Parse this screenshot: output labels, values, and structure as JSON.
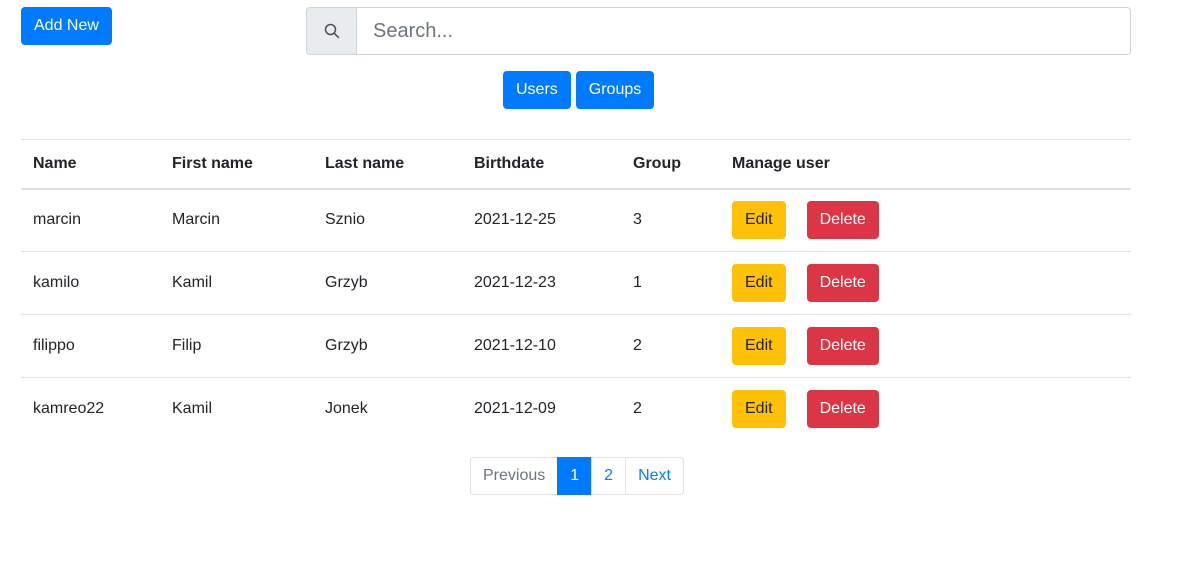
{
  "toolbar": {
    "add_new_label": "Add New"
  },
  "search": {
    "placeholder": "Search..."
  },
  "nav": {
    "users_label": "Users",
    "groups_label": "Groups"
  },
  "table": {
    "headers": [
      "Name",
      "First name",
      "Last name",
      "Birthdate",
      "Group",
      "Manage user"
    ],
    "rows": [
      {
        "name": "marcin",
        "first": "Marcin",
        "last": "Sznio",
        "birthdate": "2021-12-25",
        "group": "3"
      },
      {
        "name": "kamilo",
        "first": "Kamil",
        "last": "Grzyb",
        "birthdate": "2021-12-23",
        "group": "1"
      },
      {
        "name": "filippo",
        "first": "Filip",
        "last": "Grzyb",
        "birthdate": "2021-12-10",
        "group": "2"
      },
      {
        "name": "kamreo22",
        "first": "Kamil",
        "last": "Jonek",
        "birthdate": "2021-12-09",
        "group": "2"
      }
    ],
    "edit_label": "Edit",
    "delete_label": "Delete"
  },
  "pagination": {
    "previous_label": "Previous",
    "pages": [
      "1",
      "2"
    ],
    "active_page": "1",
    "next_label": "Next"
  },
  "colors": {
    "primary": "#007bff",
    "warning": "#ffc107",
    "danger": "#dc3545"
  }
}
